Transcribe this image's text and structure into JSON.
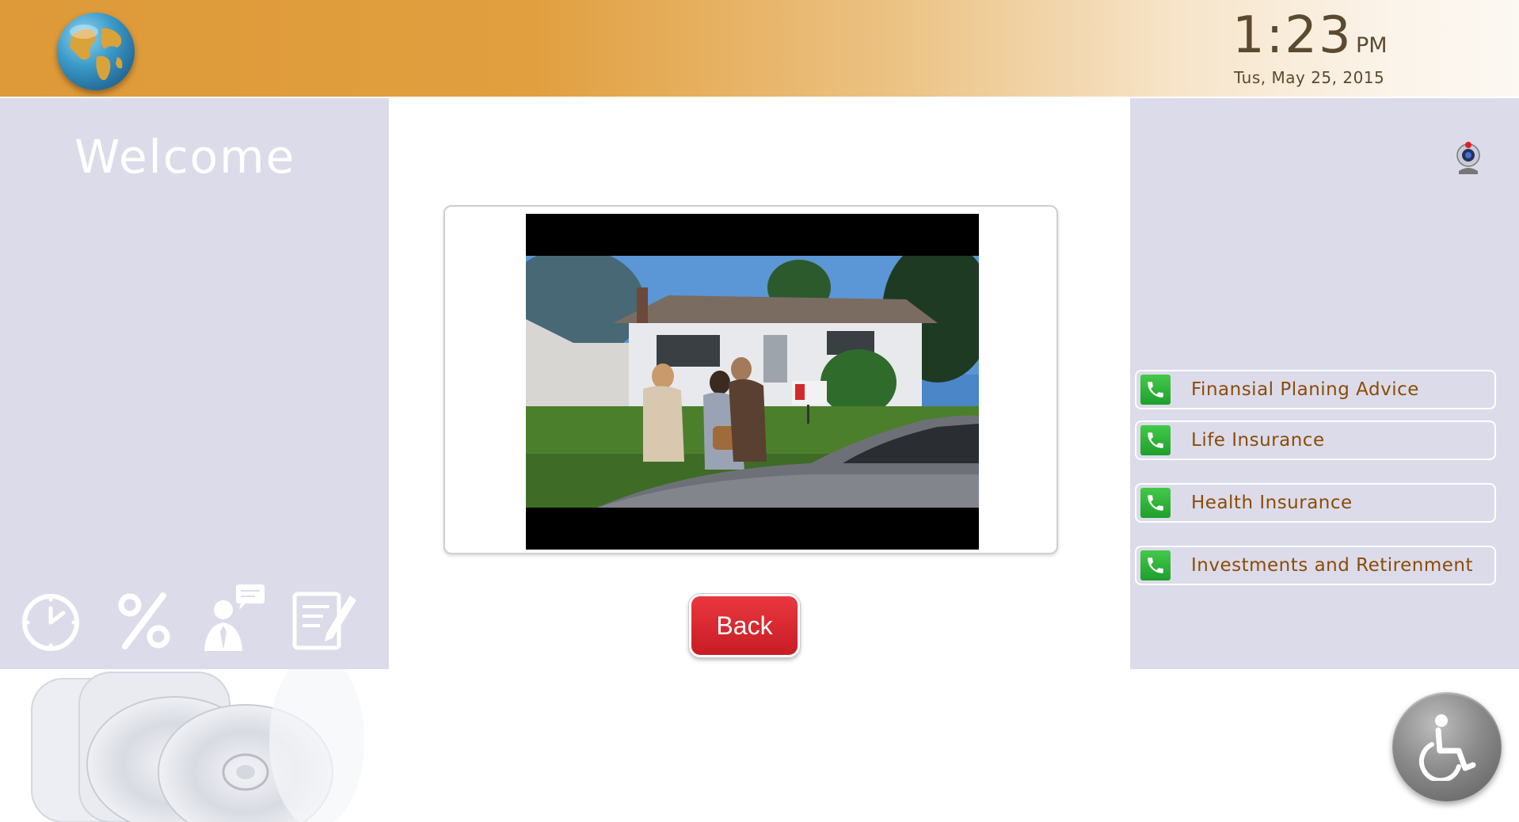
{
  "header": {
    "clock_time": "1:23",
    "clock_ampm": "PM",
    "clock_date": "Tus, May 25, 2015",
    "logo_icon": "globe-icon"
  },
  "left_panel": {
    "welcome": "Welcome",
    "tools": [
      {
        "icon": "clock-icon"
      },
      {
        "icon": "percent-icon"
      },
      {
        "icon": "advisor-chat-icon"
      },
      {
        "icon": "notepad-edit-icon"
      }
    ]
  },
  "main": {
    "video_thumbnail": "video-still-couple-house-for-sale",
    "back_label": "Back"
  },
  "right_panel": {
    "webcam_icon": "webcam-icon",
    "services": [
      {
        "label": "Finansial Planing Advice",
        "icon": "phone-icon"
      },
      {
        "label": "Life Insurance",
        "icon": "phone-icon"
      },
      {
        "label": "Health Insurance",
        "icon": "phone-icon"
      },
      {
        "label": "Investments and Retirenment",
        "icon": "phone-icon"
      }
    ]
  },
  "footer": {
    "accessibility_icon": "wheelchair-icon"
  },
  "colors": {
    "header_orange": "#de9a38",
    "panel_lavender": "#dcdbea",
    "service_text": "#8a4c06",
    "back_red": "#d9242c",
    "phone_green": "#2fb33a"
  }
}
